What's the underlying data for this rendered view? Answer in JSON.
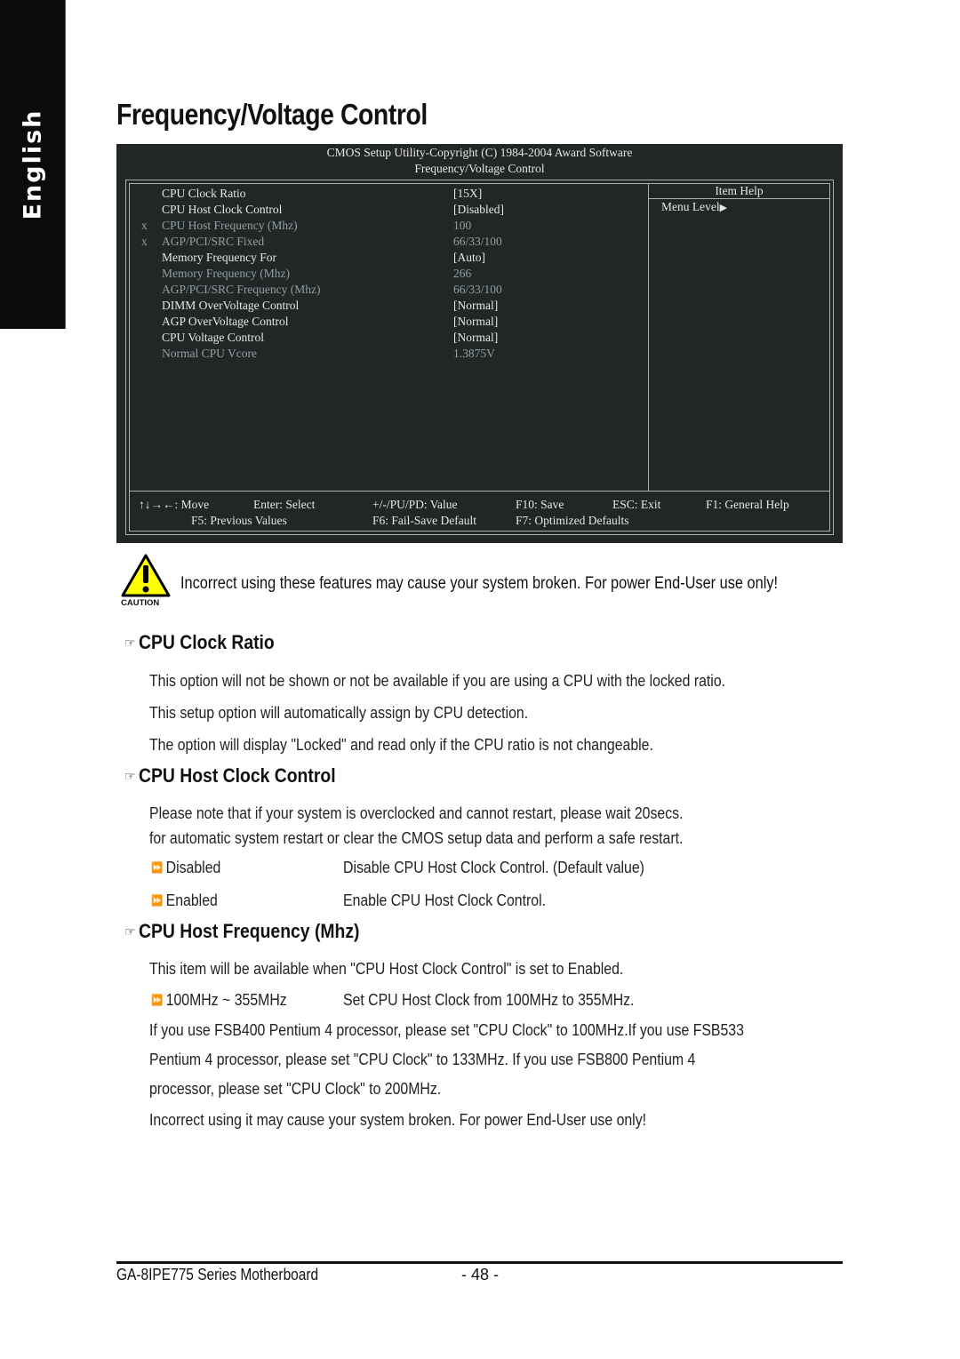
{
  "side_tab": {
    "label": "English"
  },
  "page_title": "Frequency/Voltage Control",
  "bios": {
    "header_line1": "CMOS Setup Utility-Copyright (C) 1984-2004 Award Software",
    "header_line2": "Frequency/Voltage Control",
    "items": [
      {
        "marker": "",
        "label": "CPU Clock Ratio",
        "value": "[15X]",
        "dimmed": false
      },
      {
        "marker": "",
        "label": "CPU Host Clock Control",
        "value": "[Disabled]",
        "dimmed": false
      },
      {
        "marker": "x",
        "label": "CPU Host Frequency (Mhz)",
        "value": "100",
        "dimmed": true
      },
      {
        "marker": "x",
        "label": "AGP/PCI/SRC Fixed",
        "value": "66/33/100",
        "dimmed": true
      },
      {
        "marker": "",
        "label": "Memory Frequency For",
        "value": "[Auto]",
        "dimmed": false
      },
      {
        "marker": "",
        "label": "Memory Frequency (Mhz)",
        "value": "266",
        "dimmed": true
      },
      {
        "marker": "",
        "label": "AGP/PCI/SRC Frequency (Mhz)",
        "value": "66/33/100",
        "dimmed": true
      },
      {
        "marker": "",
        "label": "DIMM OverVoltage Control",
        "value": "[Normal]",
        "dimmed": false
      },
      {
        "marker": "",
        "label": "AGP OverVoltage Control",
        "value": "[Normal]",
        "dimmed": false
      },
      {
        "marker": "",
        "label": "CPU Voltage Control",
        "value": "[Normal]",
        "dimmed": false
      },
      {
        "marker": "",
        "label": "Normal CPU Vcore",
        "value": "1.3875V",
        "dimmed": true
      }
    ],
    "help_title": "Item Help",
    "help_menu_level": "Menu Level",
    "help_menu_arrow": "▶",
    "keys_row1": {
      "move": "↑↓→←: Move",
      "select": "Enter: Select",
      "value": "+/-/PU/PD: Value",
      "save": "F10: Save",
      "exit": "ESC: Exit",
      "help": "F1: General Help"
    },
    "keys_row2": {
      "previous": "F5: Previous Values",
      "failsafe": "F6: Fail-Save Default",
      "optimized": "F7: Optimized Defaults"
    },
    "colors": {
      "background": "#222627",
      "text": "#e6e6e6",
      "dimmed_text": "#8ea19f",
      "border": "#a9b0b2"
    }
  },
  "caution": {
    "badge": "CAUTION",
    "text": "Incorrect using these features may cause your system broken. For power End-User use only!",
    "colors": {
      "triangle": "#ffff00"
    }
  },
  "sections": [
    {
      "heading": "CPU Clock Ratio",
      "paragraphs": [
        "This option will not be shown or not be available if you are using a CPU with the locked ratio.",
        "This setup option will automatically assign by CPU detection.",
        "The option will display \"Locked\" and read only if the CPU ratio is not changeable."
      ]
    },
    {
      "heading": "CPU Host Clock Control",
      "paragraphs": [
        "Please note that if your system is overclocked and cannot restart, please wait 20secs.",
        "for automatic system restart or clear the CMOS setup data and perform a safe restart."
      ],
      "options": [
        {
          "name": "Disabled",
          "desc": "Disable CPU Host Clock Control. (Default value)"
        },
        {
          "name": "Enabled",
          "desc": "Enable CPU Host  Clock Control."
        }
      ]
    },
    {
      "heading": "CPU Host Frequency (Mhz)",
      "paragraphs": [
        "This item will be available when \"CPU Host Clock Control\" is set to Enabled."
      ],
      "options": [
        {
          "name": "100MHz ~ 355MHz",
          "desc": "Set CPU Host Clock from 100MHz  to 355MHz."
        }
      ],
      "notes": [
        "If you use FSB400 Pentium 4 processor, please set \"CPU Clock\" to 100MHz.If you use FSB533",
        "Pentium 4 processor, please set \"CPU Clock\" to 133MHz. If you use FSB800 Pentium 4",
        "processor, please set \"CPU Clock\" to 200MHz.",
        "Incorrect using it may cause your system broken. For power End-User use only!"
      ]
    }
  ],
  "footer": {
    "product": "GA-8IPE775 Series Motherboard",
    "page": "- 48 -"
  }
}
